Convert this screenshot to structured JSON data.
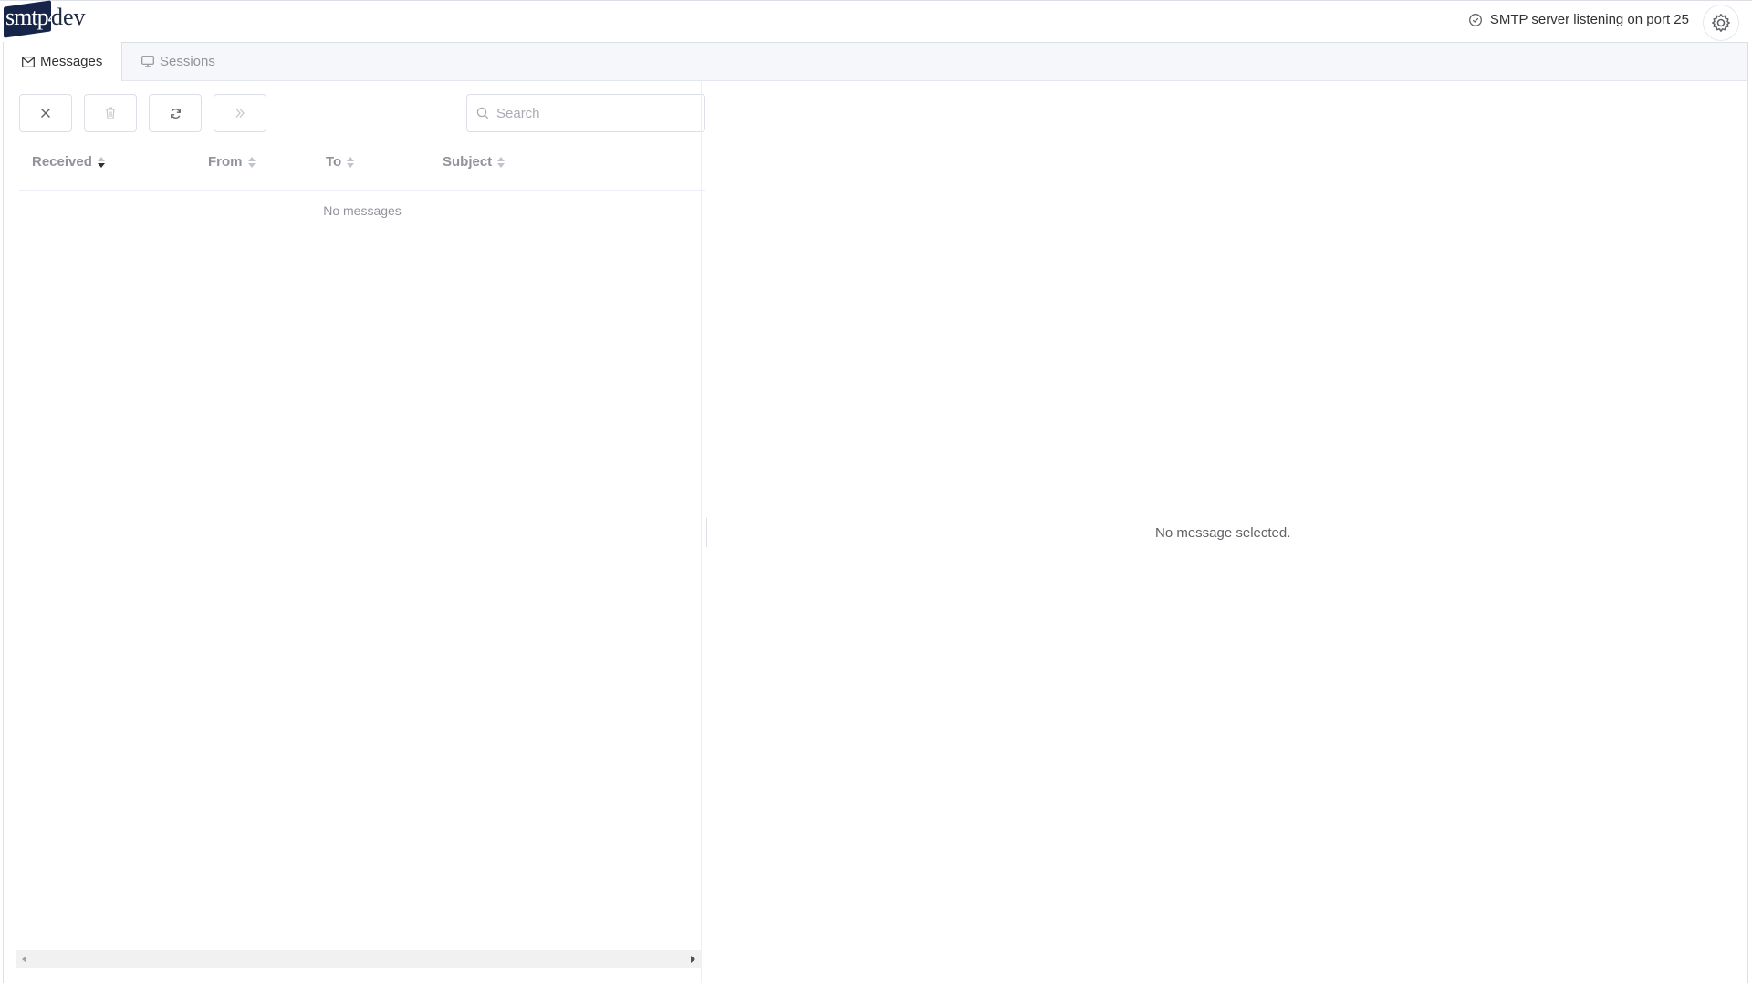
{
  "app": {
    "logo_text_a": "smtp4",
    "logo_text_b": "dev",
    "status": "SMTP server listening on port 25"
  },
  "tabs": [
    {
      "label": "Messages",
      "icon": "mail-icon",
      "active": true
    },
    {
      "label": "Sessions",
      "icon": "monitor-icon",
      "active": false
    }
  ],
  "toolbar": {
    "buttons": [
      {
        "icon": "close-icon",
        "enabled": true
      },
      {
        "icon": "trash-icon",
        "enabled": false
      },
      {
        "icon": "refresh-icon",
        "enabled": true
      },
      {
        "icon": "double-chevron-right-icon",
        "enabled": false
      }
    ],
    "search_placeholder": "Search"
  },
  "table": {
    "columns": [
      "Received",
      "From",
      "To",
      "Subject"
    ],
    "sorted_column": "Received",
    "empty_text": "No messages"
  },
  "detail": {
    "empty_text": "No message selected."
  },
  "colors": {
    "logo_badge": "#16244a",
    "border": "#dcdfe6",
    "muted_text": "#909399"
  }
}
